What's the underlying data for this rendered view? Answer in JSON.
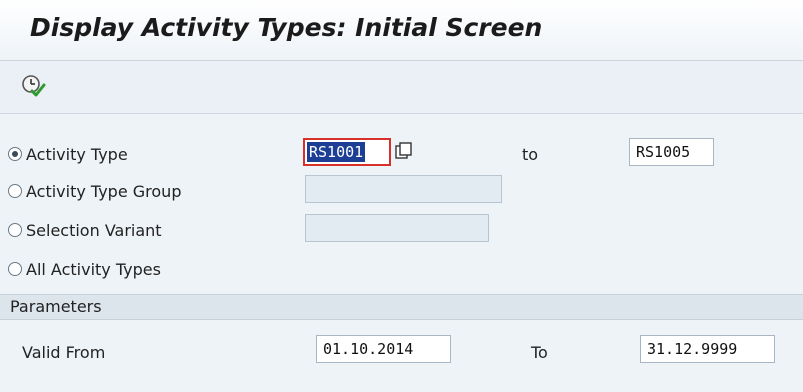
{
  "window": {
    "title": "Display Activity Types: Initial Screen"
  },
  "toolbar": {
    "execute_icon": "execute-clock-check-icon"
  },
  "selection": {
    "options": [
      {
        "label": "Activity Type",
        "selected": true
      },
      {
        "label": "Activity Type Group",
        "selected": false
      },
      {
        "label": "Selection Variant",
        "selected": false
      },
      {
        "label": "All Activity Types",
        "selected": false
      }
    ],
    "activity_type_from": "RS1001",
    "to_label": "to",
    "activity_type_to": "RS1005",
    "activity_type_group": "",
    "selection_variant": ""
  },
  "parameters": {
    "header": "Parameters",
    "valid_from_label": "Valid From",
    "valid_from": "01.10.2014",
    "to_label": "To",
    "valid_to": "31.12.9999"
  },
  "colors": {
    "selection_highlight": "#1c3f95",
    "focus_border": "#d6322b",
    "execute_icon_green": "#2e9b2e"
  }
}
